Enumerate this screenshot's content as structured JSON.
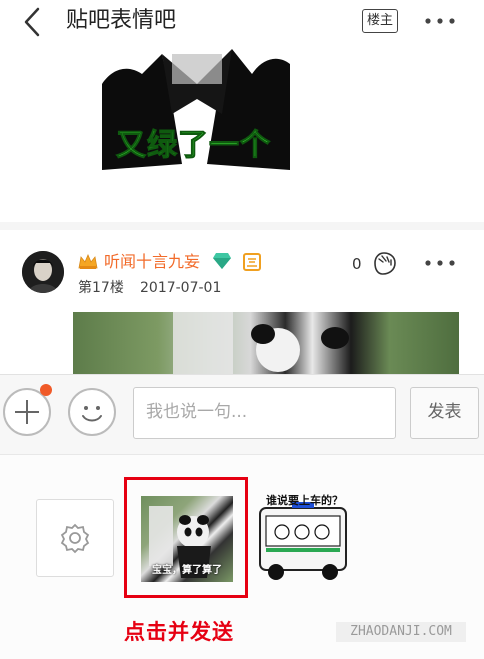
{
  "header": {
    "title": "贴吧表情吧",
    "owner_label": "楼主",
    "more_label": "···"
  },
  "meme1": {
    "caption": "又绿了一个"
  },
  "post": {
    "username": "听闻十言九妄",
    "floor": "第17楼",
    "date": "2017-07-01",
    "likes": "0"
  },
  "composer": {
    "placeholder": "我也说一句...",
    "send_label": "发表"
  },
  "stickers": {
    "sticker1_caption": "宝宝，算了算了",
    "sticker2_caption": "谁说要上车的？"
  },
  "instruction": "点击并发送",
  "watermark": "ZHAODANJI.COM",
  "colors": {
    "accent_red": "#e60012",
    "username_orange": "#f26b2a",
    "notification_dot": "#f05a28"
  }
}
